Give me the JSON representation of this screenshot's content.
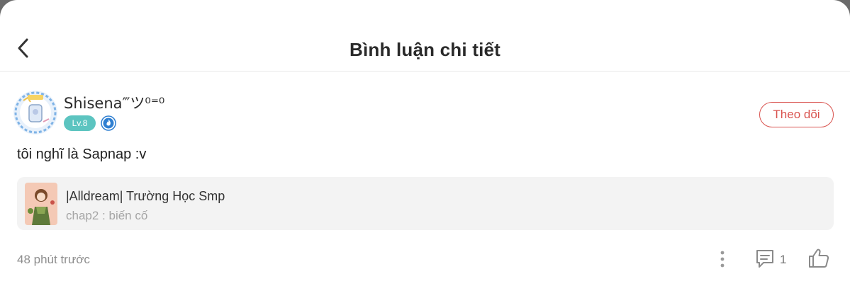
{
  "header": {
    "title": "Bình luận chi tiết",
    "back_icon": "chevron-left-icon"
  },
  "comment": {
    "username": "Shisena‴ツ⁰⁼⁰",
    "level": "Lv.8",
    "verify_icon": "flame-badge-icon",
    "follow_label": "Theo dõi",
    "text": "tôi nghĩ là Sapnap :v",
    "story": {
      "title": "|Alldream| Trường Học Smp",
      "chapter": "chap2 : biến cố"
    },
    "timestamp": "48 phút trước",
    "reply_count": "1",
    "more_icon": "more-vertical-icon",
    "reply_icon": "comment-icon",
    "like_icon": "thumbs-up-icon"
  },
  "colors": {
    "accent": "#d9534f",
    "level_badge": "#5cc4c0",
    "card_bg": "#f3f3f3",
    "muted_text": "#8e8e8e"
  }
}
